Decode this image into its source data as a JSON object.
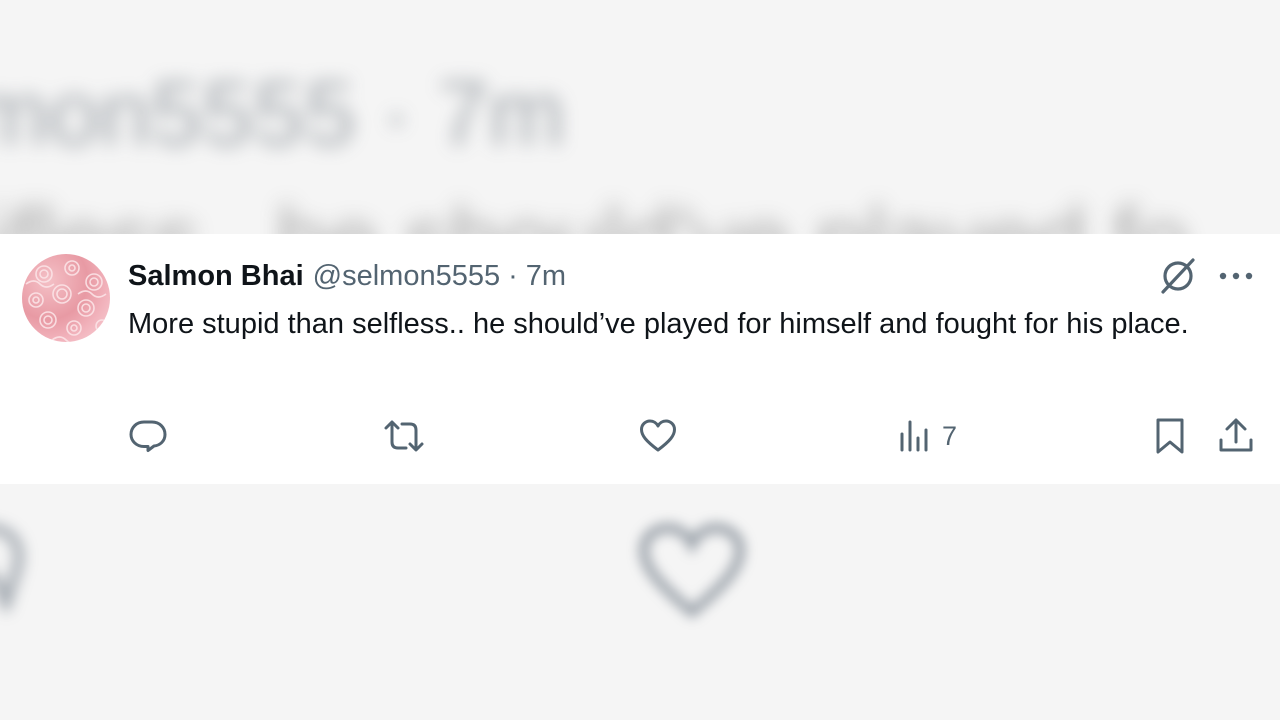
{
  "background": {
    "blurred_header": "mon5555 · 7m",
    "blurred_line": "ifless.. he should've played fo"
  },
  "tweet": {
    "display_name": "Salmon Bhai",
    "handle": "@selmon5555",
    "separator": "·",
    "time": "7m",
    "text": "More stupid than selfless.. he should’ve played for himself and fought for his place."
  },
  "actions": {
    "views_count": "7"
  },
  "icons": {
    "avatar": "avatar-pattern",
    "grok": "grok-icon",
    "more": "more-icon",
    "reply": "reply-icon",
    "retweet": "retweet-icon",
    "like": "heart-icon",
    "views": "views-icon",
    "bookmark": "bookmark-icon",
    "share": "share-icon"
  },
  "colors": {
    "text_primary": "#0f1419",
    "text_secondary": "#536471",
    "background": "#f5f5f5",
    "card": "#ffffff"
  }
}
